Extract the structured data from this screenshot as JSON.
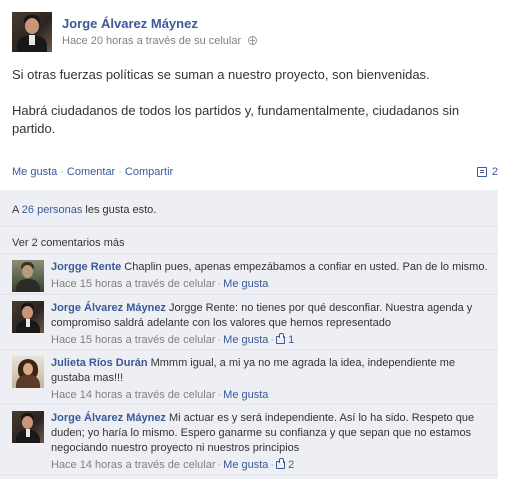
{
  "post": {
    "author": "Jorge Álvarez Máynez",
    "meta": "Hace 20 horas a través de su celular",
    "paragraphs": [
      "Si otras fuerzas políticas se suman a nuestro proyecto, son bienvenidas.",
      "Habrá ciudadanos de todos los partidos y, fundamentalmente, ciudadanos sin partido."
    ]
  },
  "actions": {
    "like": "Me gusta",
    "comment": "Comentar",
    "share": "Compartir",
    "separator": "·",
    "comment_count": "2"
  },
  "likes_summary": {
    "prefix": "A",
    "link": "26 personas",
    "suffix": "les gusta esto."
  },
  "view_more_comments": "Ver 2 comentarios más",
  "comments": [
    {
      "author": "Jorgge Rente",
      "text": "Chaplin pues, apenas empezábamos a confiar en usted. Pan de lo mismo.",
      "meta": "Hace 15 horas a través de celular",
      "like": "Me gusta",
      "likes": ""
    },
    {
      "author": "Jorge Álvarez Máynez",
      "text": "Jorgge Rente: no tienes por qué desconfiar. Nuestra agenda y compromiso saldrá adelante con los valores que hemos representado",
      "meta": "Hace 15 horas a través de celular",
      "like": "Me gusta",
      "likes": "1"
    },
    {
      "author": "Julieta Ríos Durán",
      "text": "Mmmm igual, a mi ya no me agrada la idea, independiente me gustaba mas!!!",
      "meta": "Hace 14 horas a través de celular",
      "like": "Me gusta",
      "likes": ""
    },
    {
      "author": "Jorge Álvarez Máynez",
      "text": "Mi actuar es y será independiente. Así lo ha sido. Respeto que duden; yo haría lo mismo. Espero ganarme su confianza y que sepan que no estamos negociando nuestro proyecto ni nuestros principios",
      "meta": "Hace 14 horas a través de celular",
      "like": "Me gusta",
      "likes": "2"
    }
  ],
  "colors": {
    "link": "#3b5998",
    "feedback_bg": "#edeff4",
    "meta_gray": "#808080"
  },
  "icons": [
    "globe-icon",
    "comment-count-icon",
    "thumb-icon"
  ]
}
